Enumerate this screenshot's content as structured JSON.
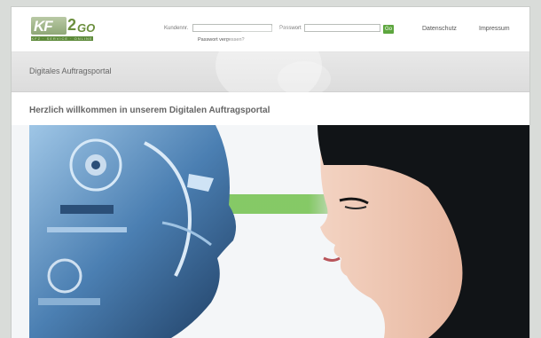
{
  "logo": {
    "kf": "KF",
    "two": "2",
    "go": "GO",
    "tagline": "KFZ · SERVICE · ONLINE"
  },
  "login": {
    "customer_label": "Kundennr.",
    "customer_value": "",
    "password_label": "Passwort",
    "password_value": "",
    "go_label": "Go",
    "forgot_label": "Passwort vergessen?"
  },
  "nav": {
    "privacy": "Datenschutz",
    "imprint": "Impressum"
  },
  "band": {
    "title": "Digitales Auftragsportal"
  },
  "welcome": "Herzlich willkommen in unserem Digitalen Auftragsportal",
  "colors": {
    "brand_green": "#5da63e",
    "logo_green": "#6c8f3e",
    "robot_blue": "#3f6f9e",
    "hair": "#111417"
  }
}
